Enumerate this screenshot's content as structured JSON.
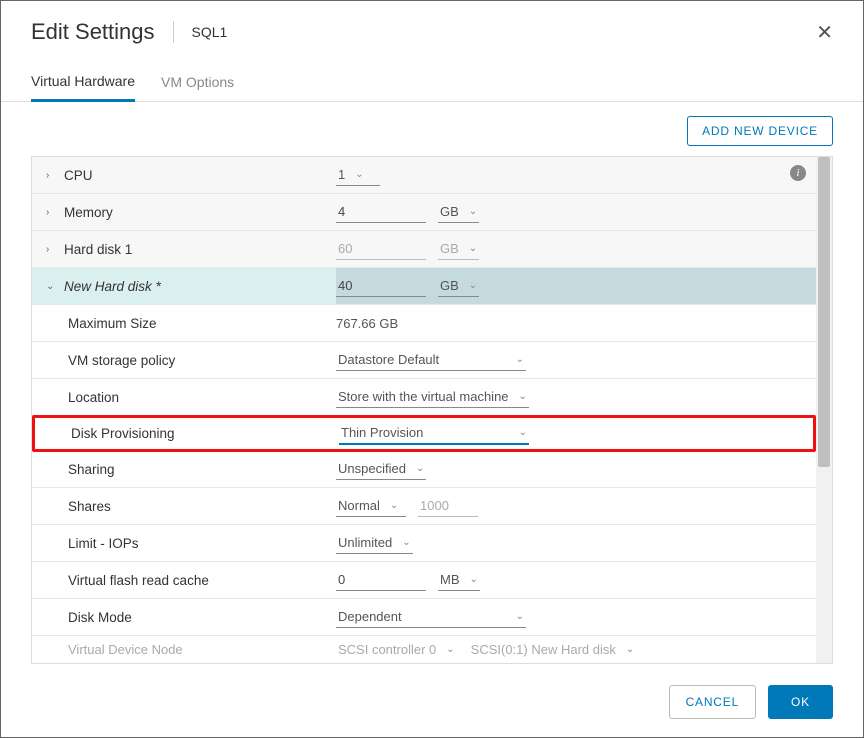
{
  "header": {
    "title": "Edit Settings",
    "subtitle": "SQL1"
  },
  "tabs": {
    "virtual_hardware": "Virtual Hardware",
    "vm_options": "VM Options"
  },
  "toolbar": {
    "add_device": "ADD NEW DEVICE"
  },
  "rows": {
    "cpu": {
      "label": "CPU",
      "value": "1"
    },
    "memory": {
      "label": "Memory",
      "value": "4",
      "unit": "GB"
    },
    "harddisk1": {
      "label": "Hard disk 1",
      "value": "60",
      "unit": "GB"
    },
    "newdisk": {
      "label": "New Hard disk *",
      "value": "40",
      "unit": "GB"
    },
    "maxsize": {
      "label": "Maximum Size",
      "value": "767.66 GB"
    },
    "storagepolicy": {
      "label": "VM storage policy",
      "value": "Datastore Default"
    },
    "location": {
      "label": "Location",
      "value": "Store with the virtual machine"
    },
    "diskprov": {
      "label": "Disk Provisioning",
      "value": "Thin Provision"
    },
    "sharing": {
      "label": "Sharing",
      "value": "Unspecified"
    },
    "shares": {
      "label": "Shares",
      "value": "Normal",
      "num": "1000"
    },
    "limit": {
      "label": "Limit - IOPs",
      "value": "Unlimited"
    },
    "vfrc": {
      "label": "Virtual flash read cache",
      "value": "0",
      "unit": "MB"
    },
    "diskmode": {
      "label": "Disk Mode",
      "value": "Dependent"
    },
    "vdn": {
      "label": "Virtual Device Node",
      "value1": "SCSI controller 0",
      "value2": "SCSI(0:1) New Hard disk"
    }
  },
  "footer": {
    "cancel": "CANCEL",
    "ok": "OK"
  }
}
